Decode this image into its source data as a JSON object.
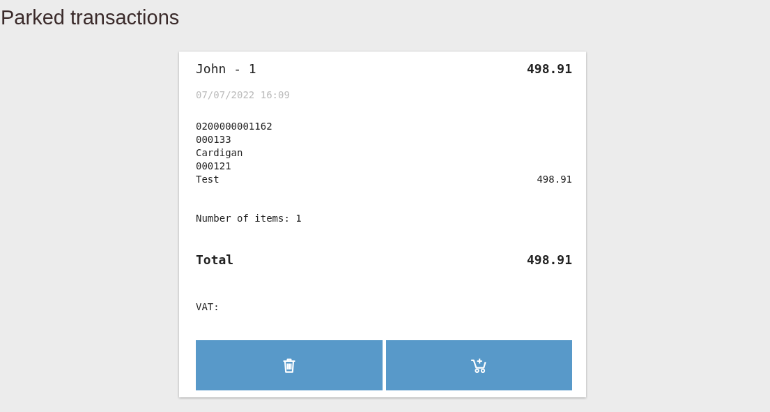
{
  "page_title": "Parked transactions",
  "transaction": {
    "name": "John - 1",
    "amount": "498.91",
    "datetime": "07/07/2022 16:09",
    "lines": [
      {
        "text": "0200000001162"
      },
      {
        "text": "000133"
      },
      {
        "text": "Cardigan"
      },
      {
        "text": "000121"
      },
      {
        "text": "Test",
        "price": "498.91"
      }
    ],
    "items_count": "Number of items: 1",
    "total_label": "Total",
    "total_amount": "498.91",
    "vat_label": "VAT:",
    "buttons": [
      {
        "kind": "delete"
      },
      {
        "kind": "add-to-cart"
      }
    ]
  }
}
